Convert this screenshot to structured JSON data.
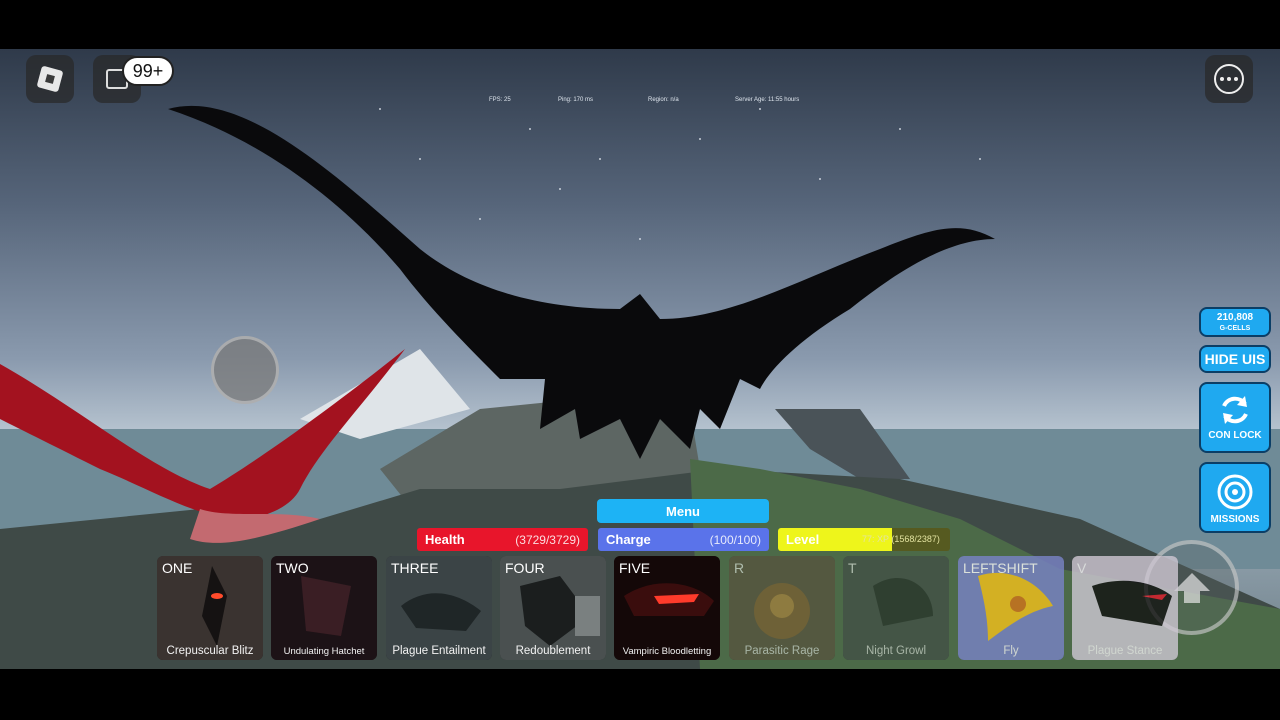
{
  "top_bar": {
    "chat_badge": "99+"
  },
  "stats": {
    "fps": "FPS: 25",
    "ping": "Ping: 170 ms",
    "region": "Region: n/a",
    "server_age": "Server Age: 11:55 hours"
  },
  "side_panel": {
    "cells_value": "210,808",
    "cells_label": "G-CELLS",
    "hide_uis": "HIDE UIS",
    "con_lock": "CON LOCK",
    "missions": "MISSIONS"
  },
  "hud": {
    "menu": "Menu",
    "health_label": "Health",
    "health_value": "(3729/3729)",
    "charge_label": "Charge",
    "charge_value": "(100/100)",
    "level_label": "Level",
    "level_xp": "77: XP (1568/2387)",
    "level_progress": 0.66
  },
  "abilities": [
    {
      "key": "ONE",
      "name": "Crepuscular Blitz"
    },
    {
      "key": "TWO",
      "name": "Undulating Hatchet"
    },
    {
      "key": "THREE",
      "name": "Plague Entailment"
    },
    {
      "key": "FOUR",
      "name": "Redoublement"
    },
    {
      "key": "FIVE",
      "name": "Vampiric Bloodletting"
    },
    {
      "key": "R",
      "name": "Parasitic Rage"
    },
    {
      "key": "T",
      "name": "Night Growl"
    },
    {
      "key": "LEFTSHIFT",
      "name": "Fly"
    },
    {
      "key": "V",
      "name": "Plague Stance"
    }
  ],
  "colors": {
    "health": "#e8152b",
    "charge": "#5a73ea",
    "level": "#eef51b",
    "accent": "#1fa9f0"
  }
}
